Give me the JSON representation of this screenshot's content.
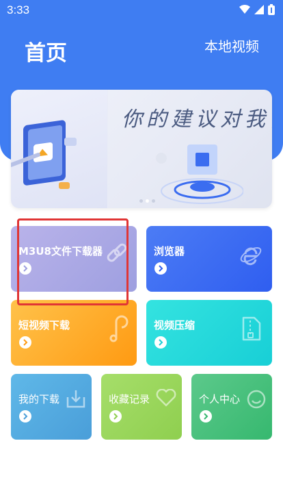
{
  "status": {
    "time": "3:33"
  },
  "header": {
    "title": "首页",
    "local_video": "本地视频"
  },
  "banner": {
    "slogan": "你的建议对我们"
  },
  "cards": {
    "m3u8": {
      "label": "M3U8文件下载器"
    },
    "browser": {
      "label": "浏览器"
    },
    "short_video": {
      "label": "短视频下载"
    },
    "compress": {
      "label": "视频压缩"
    },
    "my_downloads": {
      "label": "我的下载"
    },
    "favorites": {
      "label": "收藏记录"
    },
    "profile": {
      "label": "个人中心"
    }
  },
  "colors": {
    "brand": "#3f7df2",
    "highlight": "#e03535"
  },
  "icons": [
    "wifi-icon",
    "signal-icon",
    "battery-icon",
    "link-icon",
    "browser-e-icon",
    "music-note-icon",
    "zip-icon",
    "download-icon",
    "heart-icon",
    "smile-icon",
    "arrow-right-icon"
  ]
}
